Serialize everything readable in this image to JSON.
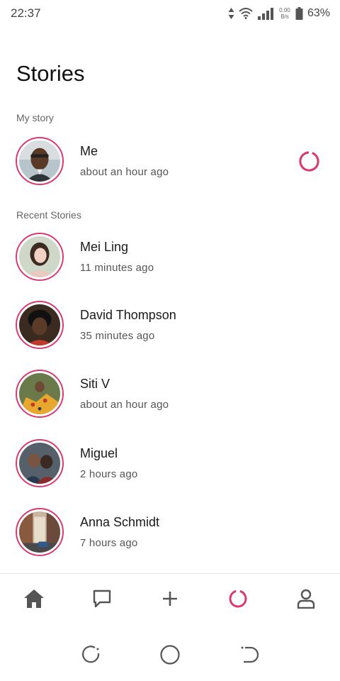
{
  "status_bar": {
    "time": "22:37",
    "net_speed_value": "0.00",
    "net_speed_unit": "B/s",
    "battery": "63%",
    "icons": [
      "data-arrows-icon",
      "wifi-icon",
      "signal-icon",
      "battery-icon"
    ]
  },
  "page": {
    "title": "Stories"
  },
  "my_story": {
    "section_label": "My story",
    "name": "Me",
    "time": "about an hour ago",
    "accent_color": "#d63b72"
  },
  "recent": {
    "section_label": "Recent Stories",
    "items": [
      {
        "name": "Mei Ling",
        "time": "11 minutes ago"
      },
      {
        "name": "David Thompson",
        "time": "35 minutes ago"
      },
      {
        "name": "Siti V",
        "time": "about an hour ago"
      },
      {
        "name": "Miguel",
        "time": "2 hours ago"
      },
      {
        "name": "Anna Schmidt",
        "time": "7 hours ago"
      }
    ]
  },
  "bottom_nav": {
    "items": [
      "home-icon",
      "chat-icon",
      "add-icon",
      "stories-icon",
      "profile-icon"
    ],
    "active": "stories-icon",
    "active_color": "#d63b72",
    "inactive_color": "#555555"
  },
  "system_nav": {
    "items": [
      "recent-apps-icon",
      "home-circle-icon",
      "back-icon"
    ]
  }
}
